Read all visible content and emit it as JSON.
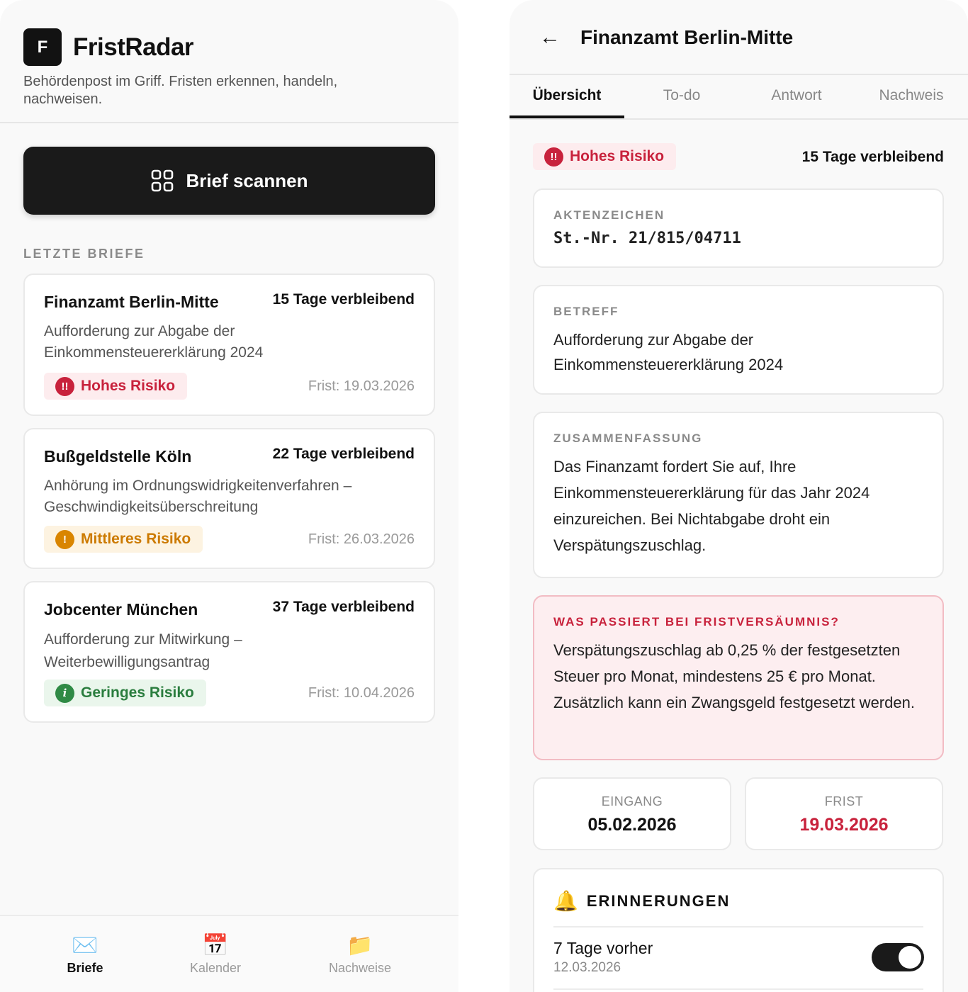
{
  "app": {
    "logo_letter": "F",
    "name": "FristRadar",
    "tagline": "Behördenpost im Griff. Fristen erkennen, handeln, nachweisen."
  },
  "scan_button": {
    "label": "Brief scannen",
    "icon": "scan-icon"
  },
  "recent": {
    "section_label": "LETZTE BRIEFE",
    "letters": [
      {
        "sender": "Finanzamt Berlin-Mitte",
        "remaining": "15 Tage verbleibend",
        "subject": "Aufforderung zur Abgabe der Einkommensteuererklärung 2024",
        "risk_label": "Hohes Risiko",
        "risk_icon": "!!",
        "deadline": "Frist: 19.03.2026"
      },
      {
        "sender": "Bußgeldstelle Köln",
        "remaining": "22 Tage verbleibend",
        "subject": "Anhörung im Ordnungswidrigkeitenverfahren – Geschwindigkeitsüberschreitung",
        "risk_label": "Mittleres Risiko",
        "risk_icon": "!",
        "deadline": "Frist: 26.03.2026"
      },
      {
        "sender": "Jobcenter München",
        "remaining": "37 Tage verbleibend",
        "subject": "Aufforderung zur Mitwirkung – Weiterbewilligungsantrag",
        "risk_label": "Geringes Risiko",
        "risk_icon": "i",
        "deadline": "Frist: 10.04.2026"
      }
    ]
  },
  "tabbar": {
    "items": [
      {
        "icon": "✉️",
        "label": "Briefe",
        "active": true
      },
      {
        "icon": "📅",
        "label": "Kalender",
        "active": false
      },
      {
        "icon": "📁",
        "label": "Nachweise",
        "active": false
      }
    ]
  },
  "detail": {
    "back_icon": "←",
    "title": "Finanzamt Berlin-Mitte",
    "tabs": [
      "Übersicht",
      "To-do",
      "Antwort",
      "Nachweis"
    ],
    "active_tab": "Übersicht",
    "risk_label": "Hohes Risiko",
    "risk_icon": "!!",
    "remaining": "15 Tage verbleibend",
    "aktenzeichen": {
      "caption": "AKTENZEICHEN",
      "value": "St.-Nr. 21/815/04711"
    },
    "betreff": {
      "caption": "BETREFF",
      "value": "Aufforderung zur Abgabe der Einkommensteuererklärung 2024"
    },
    "zusammenfassung": {
      "caption": "ZUSAMMENFASSUNG",
      "value": "Das Finanzamt fordert Sie auf, Ihre Einkommensteuererklärung für das Jahr 2024 einzureichen. Bei Nichtabgabe droht ein Verspätungszuschlag."
    },
    "warning": {
      "caption": "WAS PASSIERT BEI FRISTVERSÄUMNIS?",
      "value": "Verspätungszuschlag ab 0,25 % der festgesetzten Steuer pro Monat, mindestens 25 € pro Monat. Zusätzlich kann ein Zwangsgeld festgesetzt werden."
    },
    "eingang": {
      "label": "EINGANG",
      "value": "05.02.2026"
    },
    "frist": {
      "label": "FRIST",
      "value": "19.03.2026"
    },
    "reminders": {
      "icon": "🔔",
      "title": "ERINNERUNGEN",
      "items": [
        {
          "label": "7 Tage vorher",
          "date": "12.03.2026",
          "enabled": true
        }
      ]
    }
  },
  "colors": {
    "risk_high": "#c8223c",
    "risk_medium": "#d98500",
    "risk_low": "#2f8a45",
    "primary_dark": "#1a1a1a"
  }
}
